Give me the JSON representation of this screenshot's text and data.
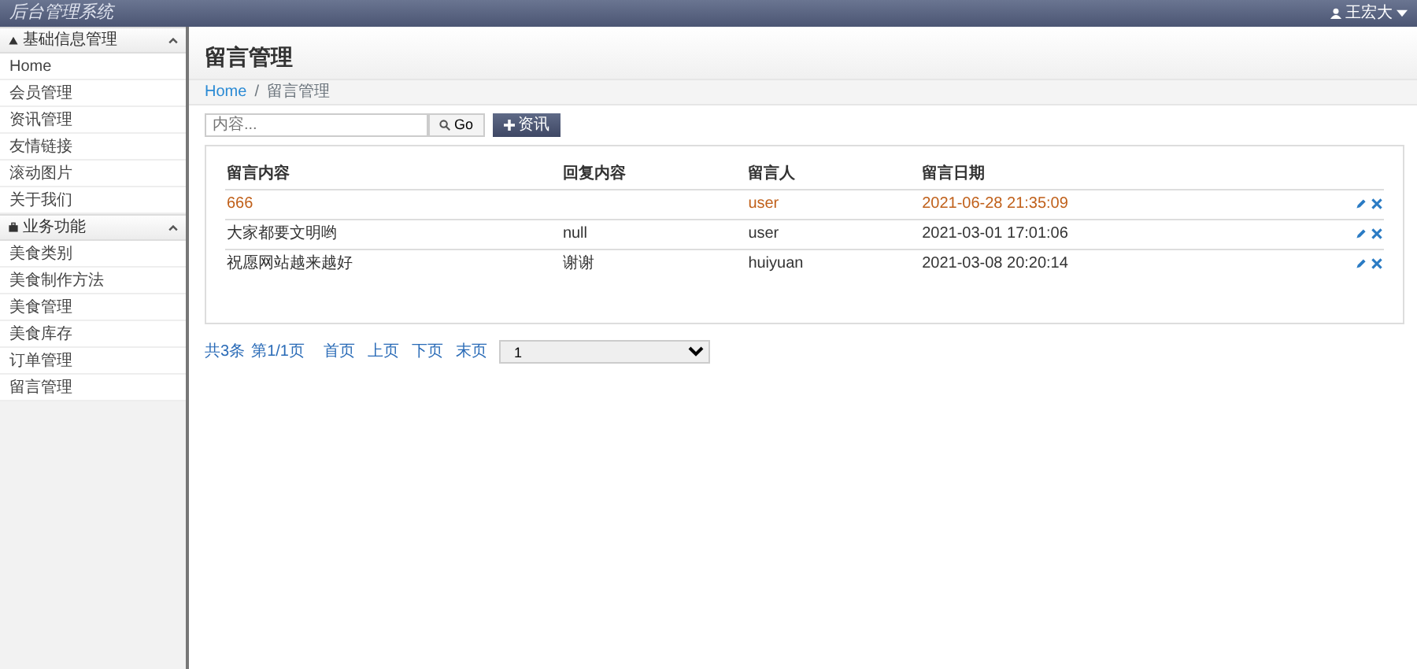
{
  "header": {
    "title": "后台管理系统",
    "user": "王宏大"
  },
  "sidebar": [
    {
      "title": "基础信息管理",
      "expanded": true,
      "items": [
        "Home",
        "会员管理",
        "资讯管理",
        "友情链接",
        "滚动图片",
        "关于我们"
      ]
    },
    {
      "title": "业务功能",
      "expanded": true,
      "items": [
        "美食类别",
        "美食制作方法",
        "美食管理",
        "美食库存",
        "订单管理",
        "留言管理"
      ]
    }
  ],
  "page_title": "留言管理",
  "breadcrumb": [
    "Home",
    "留言管理"
  ],
  "breadcrumb_separator": "/",
  "search": {
    "placeholder": "内容...",
    "button": "Go"
  },
  "add_button": "资讯",
  "table": {
    "columns": [
      "留言内容",
      "回复内容",
      "留言人",
      "留言日期"
    ],
    "rows": [
      {
        "cells": [
          "666",
          "",
          "user",
          "2021-06-28 21:35:09"
        ],
        "highlighted": true
      },
      {
        "cells": [
          "大家都要文明哟",
          "null",
          "user",
          "2021-03-01 17:01:06"
        ],
        "highlighted": false
      },
      {
        "cells": [
          "祝愿网站越来越好",
          "谢谢",
          "huiyuan",
          "2021-03-08 20:20:14"
        ],
        "highlighted": false
      }
    ]
  },
  "pagination": {
    "links": [
      "共3条",
      "第1/1页",
      "首页",
      "上页",
      "下页",
      "末页"
    ],
    "page_select": "1"
  }
}
